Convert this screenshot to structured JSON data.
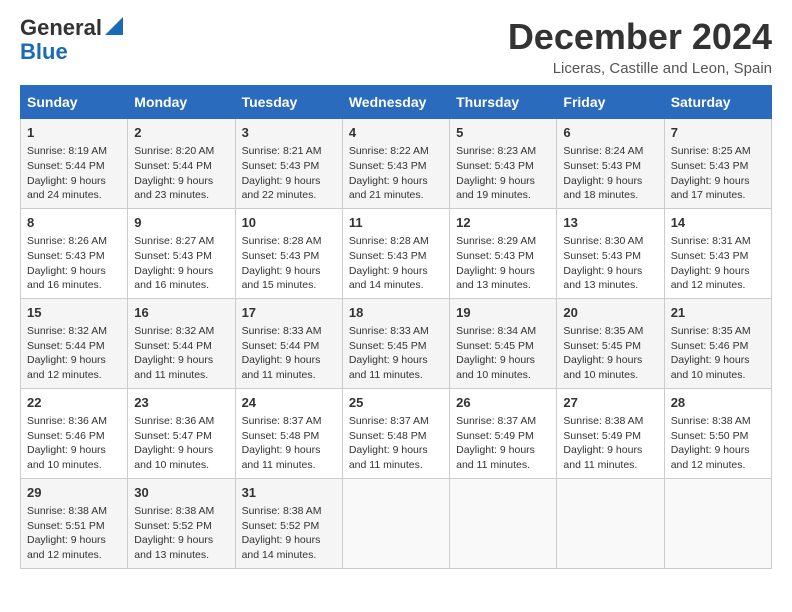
{
  "header": {
    "logo_general": "General",
    "logo_blue": "Blue",
    "month": "December 2024",
    "location": "Liceras, Castille and Leon, Spain"
  },
  "days_of_week": [
    "Sunday",
    "Monday",
    "Tuesday",
    "Wednesday",
    "Thursday",
    "Friday",
    "Saturday"
  ],
  "weeks": [
    [
      {
        "day": "1",
        "lines": [
          "Sunrise: 8:19 AM",
          "Sunset: 5:44 PM",
          "Daylight: 9 hours",
          "and 24 minutes."
        ]
      },
      {
        "day": "2",
        "lines": [
          "Sunrise: 8:20 AM",
          "Sunset: 5:44 PM",
          "Daylight: 9 hours",
          "and 23 minutes."
        ]
      },
      {
        "day": "3",
        "lines": [
          "Sunrise: 8:21 AM",
          "Sunset: 5:43 PM",
          "Daylight: 9 hours",
          "and 22 minutes."
        ]
      },
      {
        "day": "4",
        "lines": [
          "Sunrise: 8:22 AM",
          "Sunset: 5:43 PM",
          "Daylight: 9 hours",
          "and 21 minutes."
        ]
      },
      {
        "day": "5",
        "lines": [
          "Sunrise: 8:23 AM",
          "Sunset: 5:43 PM",
          "Daylight: 9 hours",
          "and 19 minutes."
        ]
      },
      {
        "day": "6",
        "lines": [
          "Sunrise: 8:24 AM",
          "Sunset: 5:43 PM",
          "Daylight: 9 hours",
          "and 18 minutes."
        ]
      },
      {
        "day": "7",
        "lines": [
          "Sunrise: 8:25 AM",
          "Sunset: 5:43 PM",
          "Daylight: 9 hours",
          "and 17 minutes."
        ]
      }
    ],
    [
      {
        "day": "8",
        "lines": [
          "Sunrise: 8:26 AM",
          "Sunset: 5:43 PM",
          "Daylight: 9 hours",
          "and 16 minutes."
        ]
      },
      {
        "day": "9",
        "lines": [
          "Sunrise: 8:27 AM",
          "Sunset: 5:43 PM",
          "Daylight: 9 hours",
          "and 16 minutes."
        ]
      },
      {
        "day": "10",
        "lines": [
          "Sunrise: 8:28 AM",
          "Sunset: 5:43 PM",
          "Daylight: 9 hours",
          "and 15 minutes."
        ]
      },
      {
        "day": "11",
        "lines": [
          "Sunrise: 8:28 AM",
          "Sunset: 5:43 PM",
          "Daylight: 9 hours",
          "and 14 minutes."
        ]
      },
      {
        "day": "12",
        "lines": [
          "Sunrise: 8:29 AM",
          "Sunset: 5:43 PM",
          "Daylight: 9 hours",
          "and 13 minutes."
        ]
      },
      {
        "day": "13",
        "lines": [
          "Sunrise: 8:30 AM",
          "Sunset: 5:43 PM",
          "Daylight: 9 hours",
          "and 13 minutes."
        ]
      },
      {
        "day": "14",
        "lines": [
          "Sunrise: 8:31 AM",
          "Sunset: 5:43 PM",
          "Daylight: 9 hours",
          "and 12 minutes."
        ]
      }
    ],
    [
      {
        "day": "15",
        "lines": [
          "Sunrise: 8:32 AM",
          "Sunset: 5:44 PM",
          "Daylight: 9 hours",
          "and 12 minutes."
        ]
      },
      {
        "day": "16",
        "lines": [
          "Sunrise: 8:32 AM",
          "Sunset: 5:44 PM",
          "Daylight: 9 hours",
          "and 11 minutes."
        ]
      },
      {
        "day": "17",
        "lines": [
          "Sunrise: 8:33 AM",
          "Sunset: 5:44 PM",
          "Daylight: 9 hours",
          "and 11 minutes."
        ]
      },
      {
        "day": "18",
        "lines": [
          "Sunrise: 8:33 AM",
          "Sunset: 5:45 PM",
          "Daylight: 9 hours",
          "and 11 minutes."
        ]
      },
      {
        "day": "19",
        "lines": [
          "Sunrise: 8:34 AM",
          "Sunset: 5:45 PM",
          "Daylight: 9 hours",
          "and 10 minutes."
        ]
      },
      {
        "day": "20",
        "lines": [
          "Sunrise: 8:35 AM",
          "Sunset: 5:45 PM",
          "Daylight: 9 hours",
          "and 10 minutes."
        ]
      },
      {
        "day": "21",
        "lines": [
          "Sunrise: 8:35 AM",
          "Sunset: 5:46 PM",
          "Daylight: 9 hours",
          "and 10 minutes."
        ]
      }
    ],
    [
      {
        "day": "22",
        "lines": [
          "Sunrise: 8:36 AM",
          "Sunset: 5:46 PM",
          "Daylight: 9 hours",
          "and 10 minutes."
        ]
      },
      {
        "day": "23",
        "lines": [
          "Sunrise: 8:36 AM",
          "Sunset: 5:47 PM",
          "Daylight: 9 hours",
          "and 10 minutes."
        ]
      },
      {
        "day": "24",
        "lines": [
          "Sunrise: 8:37 AM",
          "Sunset: 5:48 PM",
          "Daylight: 9 hours",
          "and 11 minutes."
        ]
      },
      {
        "day": "25",
        "lines": [
          "Sunrise: 8:37 AM",
          "Sunset: 5:48 PM",
          "Daylight: 9 hours",
          "and 11 minutes."
        ]
      },
      {
        "day": "26",
        "lines": [
          "Sunrise: 8:37 AM",
          "Sunset: 5:49 PM",
          "Daylight: 9 hours",
          "and 11 minutes."
        ]
      },
      {
        "day": "27",
        "lines": [
          "Sunrise: 8:38 AM",
          "Sunset: 5:49 PM",
          "Daylight: 9 hours",
          "and 11 minutes."
        ]
      },
      {
        "day": "28",
        "lines": [
          "Sunrise: 8:38 AM",
          "Sunset: 5:50 PM",
          "Daylight: 9 hours",
          "and 12 minutes."
        ]
      }
    ],
    [
      {
        "day": "29",
        "lines": [
          "Sunrise: 8:38 AM",
          "Sunset: 5:51 PM",
          "Daylight: 9 hours",
          "and 12 minutes."
        ]
      },
      {
        "day": "30",
        "lines": [
          "Sunrise: 8:38 AM",
          "Sunset: 5:52 PM",
          "Daylight: 9 hours",
          "and 13 minutes."
        ]
      },
      {
        "day": "31",
        "lines": [
          "Sunrise: 8:38 AM",
          "Sunset: 5:52 PM",
          "Daylight: 9 hours",
          "and 14 minutes."
        ]
      },
      {
        "day": "",
        "lines": []
      },
      {
        "day": "",
        "lines": []
      },
      {
        "day": "",
        "lines": []
      },
      {
        "day": "",
        "lines": []
      }
    ]
  ]
}
